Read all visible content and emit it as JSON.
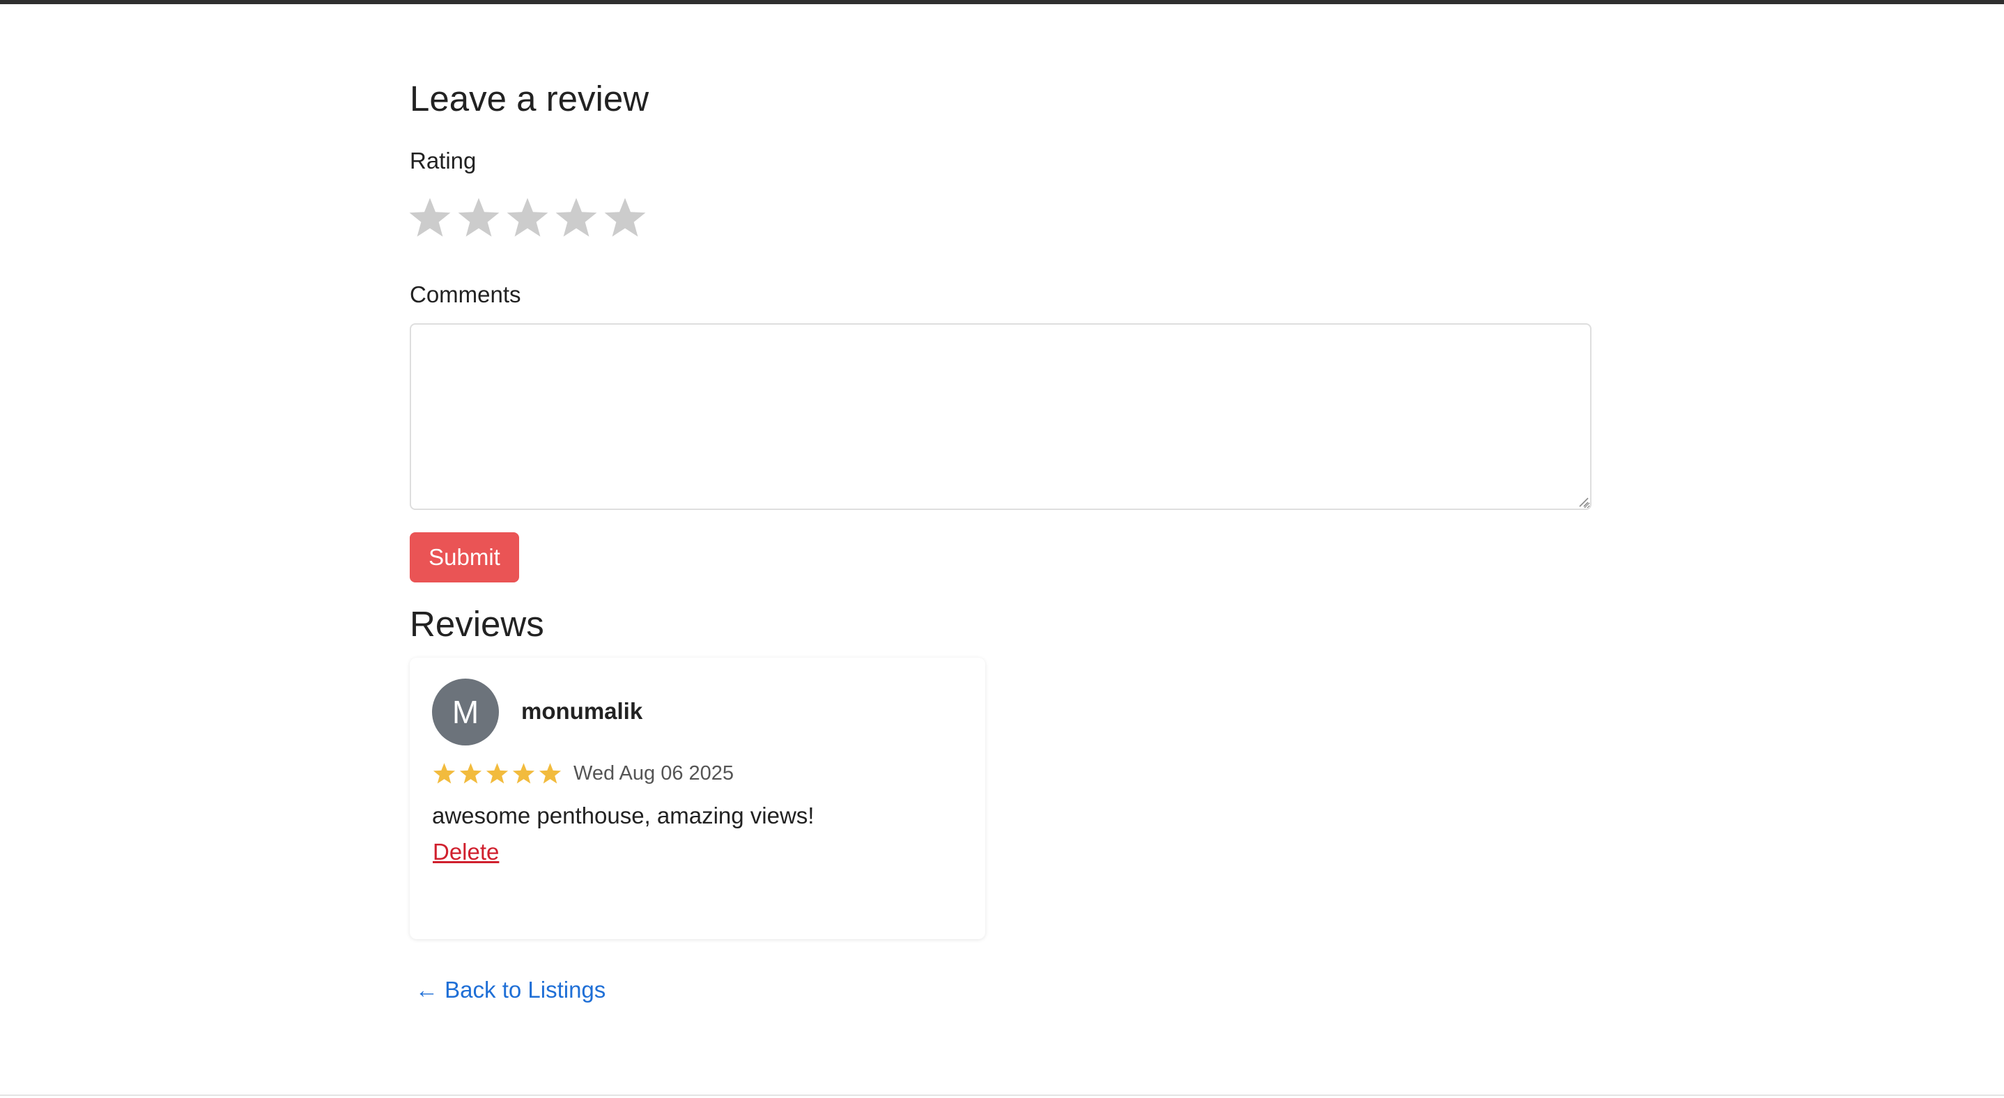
{
  "review_form": {
    "heading": "Leave a review",
    "rating_label": "Rating",
    "rating_value": 0,
    "rating_max": 5,
    "comments_label": "Comments",
    "comments_value": "",
    "submit_label": "Submit",
    "star_empty_color": "#cccccc",
    "submit_color": "#ea5455"
  },
  "reviews": {
    "heading": "Reviews",
    "items": [
      {
        "avatar_initial": "M",
        "username": "monumalik",
        "rating": 5,
        "date": "Wed Aug 06 2025",
        "comment": "awesome penthouse, amazing views!",
        "delete_label": "Delete",
        "star_color": "#f2bb3d"
      }
    ]
  },
  "navigation": {
    "back_label": "← Back to Listings",
    "link_color": "#1f6fd6"
  },
  "icons": {
    "rating_star": "star-icon",
    "textarea_grip": "resize-grip-icon"
  }
}
